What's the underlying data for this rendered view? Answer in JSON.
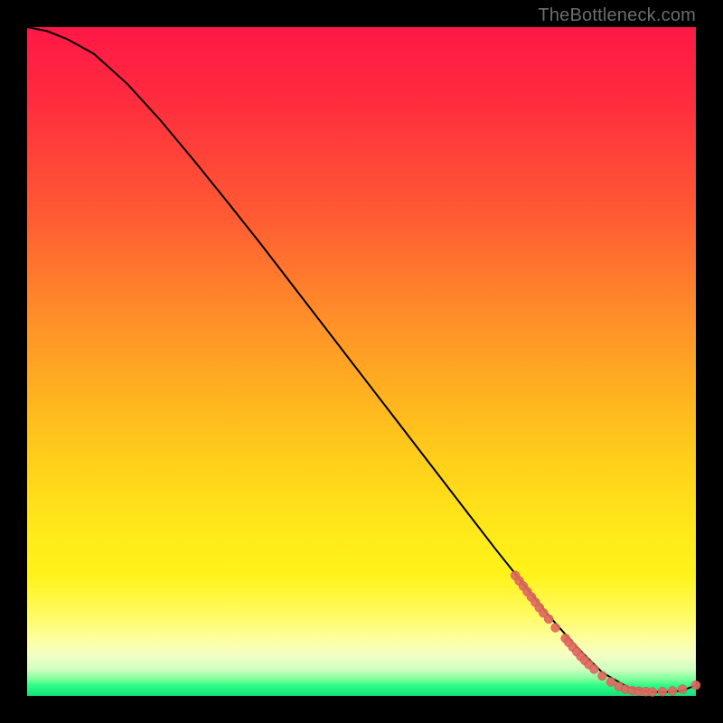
{
  "watermark": "TheBottleneck.com",
  "colors": {
    "curve_stroke": "#000000",
    "marker_fill": "#e0695f",
    "marker_stroke": "#c9544c"
  },
  "chart_data": {
    "type": "line",
    "title": "",
    "xlabel": "",
    "ylabel": "",
    "xlim": [
      0,
      100
    ],
    "ylim": [
      0,
      100
    ],
    "series": [
      {
        "name": "curve",
        "x": [
          0,
          3,
          6,
          10,
          15,
          20,
          25,
          30,
          35,
          40,
          45,
          50,
          55,
          60,
          65,
          70,
          74,
          78,
          82,
          86,
          90,
          93,
          96,
          98,
          100
        ],
        "y": [
          100,
          99.4,
          98.2,
          96.0,
          91.5,
          86.0,
          80.0,
          73.8,
          67.5,
          61.0,
          54.5,
          48.0,
          41.5,
          35.0,
          28.5,
          22.0,
          17.0,
          12.0,
          7.5,
          3.5,
          1.2,
          0.6,
          0.6,
          0.8,
          1.6
        ]
      }
    ],
    "markers": [
      {
        "x": 73.0,
        "y": 18.0,
        "r": 5
      },
      {
        "x": 73.6,
        "y": 17.2,
        "r": 5
      },
      {
        "x": 74.2,
        "y": 16.4,
        "r": 5
      },
      {
        "x": 74.8,
        "y": 15.6,
        "r": 5
      },
      {
        "x": 75.4,
        "y": 14.8,
        "r": 5
      },
      {
        "x": 76.0,
        "y": 14.0,
        "r": 5
      },
      {
        "x": 76.6,
        "y": 13.2,
        "r": 5
      },
      {
        "x": 77.2,
        "y": 12.4,
        "r": 5
      },
      {
        "x": 78.0,
        "y": 11.5,
        "r": 5
      },
      {
        "x": 79.0,
        "y": 10.2,
        "r": 5
      },
      {
        "x": 80.5,
        "y": 8.6,
        "r": 5
      },
      {
        "x": 81.0,
        "y": 8.0,
        "r": 5
      },
      {
        "x": 81.6,
        "y": 7.3,
        "r": 5
      },
      {
        "x": 82.2,
        "y": 6.6,
        "r": 5
      },
      {
        "x": 82.8,
        "y": 5.9,
        "r": 5
      },
      {
        "x": 83.4,
        "y": 5.3,
        "r": 5
      },
      {
        "x": 84.0,
        "y": 4.7,
        "r": 5
      },
      {
        "x": 84.8,
        "y": 4.0,
        "r": 5
      },
      {
        "x": 86.0,
        "y": 3.0,
        "r": 5
      },
      {
        "x": 87.3,
        "y": 2.1,
        "r": 5
      },
      {
        "x": 88.5,
        "y": 1.4,
        "r": 5
      },
      {
        "x": 89.5,
        "y": 1.0,
        "r": 5
      },
      {
        "x": 90.5,
        "y": 0.8,
        "r": 5
      },
      {
        "x": 91.5,
        "y": 0.7,
        "r": 5
      },
      {
        "x": 92.5,
        "y": 0.65,
        "r": 5
      },
      {
        "x": 93.5,
        "y": 0.6,
        "r": 5
      },
      {
        "x": 95.0,
        "y": 0.65,
        "r": 5
      },
      {
        "x": 96.5,
        "y": 0.75,
        "r": 5
      },
      {
        "x": 98.0,
        "y": 1.0,
        "r": 5
      },
      {
        "x": 100.0,
        "y": 1.6,
        "r": 5
      }
    ]
  }
}
